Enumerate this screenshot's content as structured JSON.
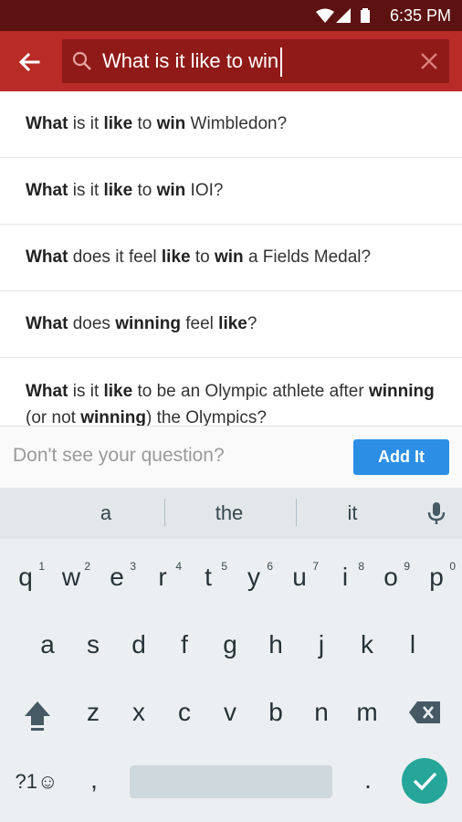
{
  "status_bar": {
    "time": "6:35 PM"
  },
  "search": {
    "query": "What is it like to win"
  },
  "suggestions": [
    {
      "parts": [
        {
          "t": "What",
          "b": true
        },
        {
          "t": " is it ",
          "b": false
        },
        {
          "t": "like",
          "b": true
        },
        {
          "t": " to ",
          "b": false
        },
        {
          "t": "win",
          "b": true
        },
        {
          "t": " Wimbledon?",
          "b": false
        }
      ]
    },
    {
      "parts": [
        {
          "t": "What",
          "b": true
        },
        {
          "t": " is it ",
          "b": false
        },
        {
          "t": "like",
          "b": true
        },
        {
          "t": " to ",
          "b": false
        },
        {
          "t": "win",
          "b": true
        },
        {
          "t": " IOI?",
          "b": false
        }
      ]
    },
    {
      "parts": [
        {
          "t": "What",
          "b": true
        },
        {
          "t": " does it feel ",
          "b": false
        },
        {
          "t": "like",
          "b": true
        },
        {
          "t": " to ",
          "b": false
        },
        {
          "t": "win",
          "b": true
        },
        {
          "t": " a Fields Medal?",
          "b": false
        }
      ]
    },
    {
      "parts": [
        {
          "t": "What",
          "b": true
        },
        {
          "t": " does ",
          "b": false
        },
        {
          "t": "winning",
          "b": true
        },
        {
          "t": " feel ",
          "b": false
        },
        {
          "t": "like",
          "b": true
        },
        {
          "t": "?",
          "b": false
        }
      ]
    },
    {
      "parts": [
        {
          "t": "What",
          "b": true
        },
        {
          "t": " is it ",
          "b": false
        },
        {
          "t": "like",
          "b": true
        },
        {
          "t": " to be an Olympic athlete after ",
          "b": false
        },
        {
          "t": "winning",
          "b": true
        },
        {
          "t": " (or not ",
          "b": false
        },
        {
          "t": "winning",
          "b": true
        },
        {
          "t": ") the Olympics?",
          "b": false
        }
      ]
    }
  ],
  "ask_bar": {
    "prompt": "Don't see your question?",
    "button": "Add It"
  },
  "keyboard": {
    "suggestions": [
      "a",
      "the",
      "it"
    ],
    "row1": [
      {
        "k": "q",
        "h": "1"
      },
      {
        "k": "w",
        "h": "2"
      },
      {
        "k": "e",
        "h": "3"
      },
      {
        "k": "r",
        "h": "4"
      },
      {
        "k": "t",
        "h": "5"
      },
      {
        "k": "y",
        "h": "6"
      },
      {
        "k": "u",
        "h": "7"
      },
      {
        "k": "i",
        "h": "8"
      },
      {
        "k": "o",
        "h": "9"
      },
      {
        "k": "p",
        "h": "0"
      }
    ],
    "row2": [
      "a",
      "s",
      "d",
      "f",
      "g",
      "h",
      "j",
      "k",
      "l"
    ],
    "row3": [
      "z",
      "x",
      "c",
      "v",
      "b",
      "n",
      "m"
    ],
    "symbols_key": "?1☺",
    "comma": ",",
    "period": "."
  },
  "colors": {
    "app_bar": "#b92b27",
    "status_bar": "#5c1211",
    "accent": "#2c8fe5",
    "enter": "#26a69a"
  },
  "icons": [
    "back-arrow-icon",
    "search-icon",
    "clear-icon",
    "mic-icon",
    "shift-icon",
    "backspace-icon",
    "check-icon",
    "wifi-icon",
    "signal-icon",
    "battery-icon"
  ]
}
